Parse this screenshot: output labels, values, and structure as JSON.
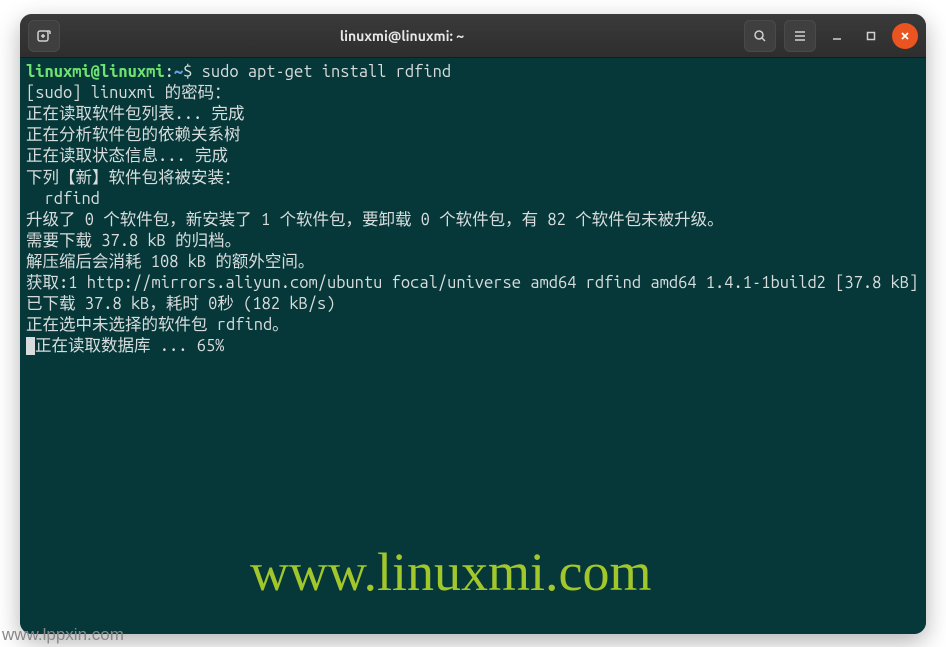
{
  "window": {
    "title": "linuxmi@linuxmi: ~"
  },
  "prompt": {
    "user_host": "linuxmi@linuxmi",
    "separator": ":",
    "path": "~",
    "symbol": "$",
    "command": "sudo apt-get install rdfind"
  },
  "output": {
    "lines": [
      "[sudo] linuxmi 的密码：",
      "正在读取软件包列表... 完成",
      "正在分析软件包的依赖关系树",
      "正在读取状态信息... 完成",
      "下列【新】软件包将被安装：",
      "  rdfind",
      "升级了 0 个软件包，新安装了 1 个软件包，要卸载 0 个软件包，有 82 个软件包未被升级。",
      "需要下载 37.8 kB 的归档。",
      "解压缩后会消耗 108 kB 的额外空间。",
      "获取:1 http://mirrors.aliyun.com/ubuntu focal/universe amd64 rdfind amd64 1.4.1-1build2 [37.8 kB]",
      "已下载 37.8 kB，耗时 0秒 (182 kB/s)",
      "正在选中未选择的软件包 rdfind。"
    ],
    "progress_prefix": "(",
    "progress_text": "正在读取数据库 ... 65%"
  },
  "watermark": {
    "main": "www.linuxmi.com",
    "bottom": "www.lppxin.com"
  }
}
